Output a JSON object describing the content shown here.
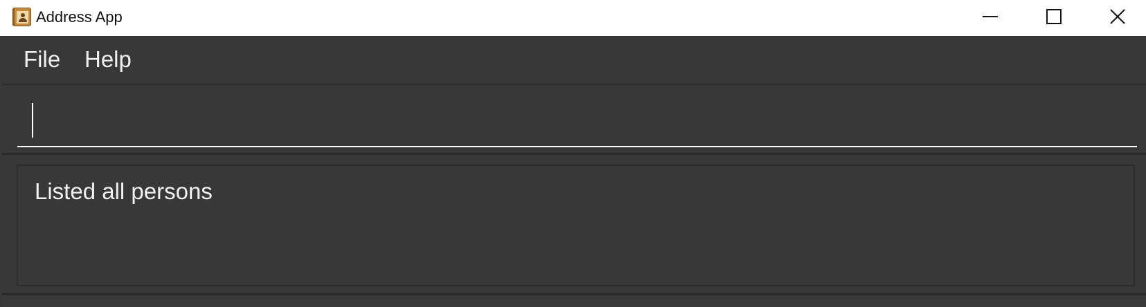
{
  "window": {
    "title": "Address App",
    "app_icon": "address-book-icon",
    "controls": {
      "minimize_icon": "minimize-icon",
      "maximize_icon": "maximize-icon",
      "close_icon": "close-icon"
    }
  },
  "menubar": {
    "items": [
      {
        "label": "File"
      },
      {
        "label": "Help"
      }
    ]
  },
  "command_box": {
    "value": "",
    "placeholder": ""
  },
  "result_display": {
    "text": "Listed all persons"
  },
  "colors": {
    "background": "#383838",
    "border": "#2a2a2a",
    "text": "#f0f0f0",
    "titlebar": "#ffffff"
  }
}
